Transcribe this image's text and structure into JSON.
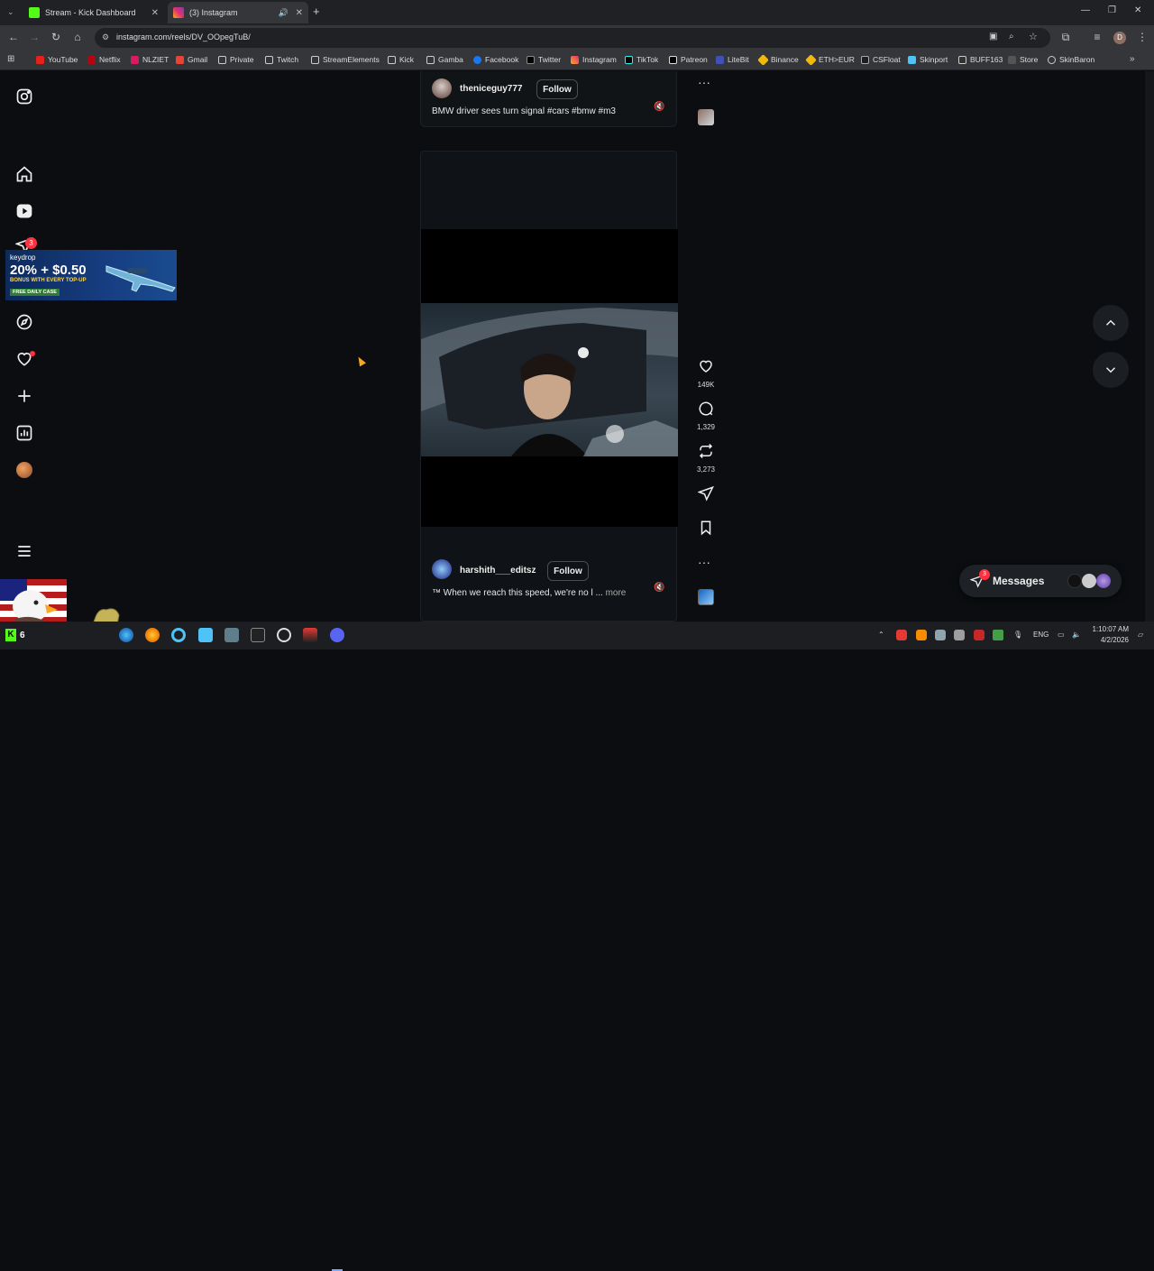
{
  "browser": {
    "tabs": [
      {
        "title": "Stream - Kick Dashboard",
        "active": false
      },
      {
        "title": "(3) Instagram",
        "active": true
      }
    ],
    "url": "instagram.com/reels/DV_OOpegTuB/",
    "bookmarks": [
      "YouTube",
      "Netflix",
      "NLZIET",
      "Gmail",
      "Private",
      "Twitch",
      "StreamElements",
      "Kick",
      "Gamba",
      "Facebook",
      "Twitter",
      "Instagram",
      "TikTok",
      "Patreon",
      "LiteBit",
      "Binance",
      "ETH>EUR",
      "CSFloat",
      "Skinport",
      "BUFF163",
      "Store",
      "SkinBaron"
    ]
  },
  "sidebar": {
    "notification_badge": "3"
  },
  "ad": {
    "brand": "keydrop",
    "headline": "20% + $0.50",
    "subline": "BONUS WITH EVERY TOP-UP",
    "tag": "FREE DAILY CASE"
  },
  "reel_top": {
    "username": "theniceguy777",
    "follow_label": "Follow",
    "caption": "BMW driver sees turn signal #cars #bmw #m3"
  },
  "reel_main": {
    "username": "harshith___editsz",
    "follow_label": "Follow",
    "caption": "™ When we reach this speed, we're no l ...",
    "more_label": "more",
    "likes": "149K",
    "comments": "1,329",
    "reposts": "3,273"
  },
  "messages": {
    "label": "Messages",
    "badge": "3"
  },
  "taskbar": {
    "lang": "ENG",
    "time": "1:10:07 AM",
    "date": "4/2/2026",
    "tray_k_count": "6"
  }
}
